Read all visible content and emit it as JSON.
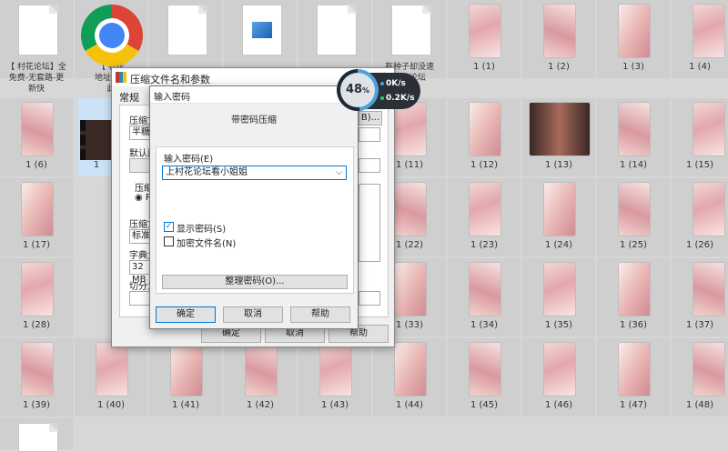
{
  "desktop": {
    "docs": [
      {
        "lines": [
          "【 村花论坛】全",
          "免费-无套路-更",
          "新快"
        ]
      },
      {
        "lines": [
          "【 村花",
          "地址发布",
          "此"
        ]
      },
      {
        "lines": [
          "",
          "",
          ""
        ]
      },
      {
        "lines": [
          "",
          "",
          ""
        ]
      },
      {
        "lines": [
          "",
          "",
          ""
        ]
      },
      {
        "lines": [
          "有种子却没速",
          "村花论坛",
          "是】"
        ]
      }
    ],
    "captions": {
      "row0": [
        "1 (1)",
        "1 (2)",
        "1 (3)",
        "1 (4)"
      ],
      "row1": [
        "1 (6)",
        "1",
        "1 (11)",
        "1 (12)",
        "1 (13)",
        "1 (14)",
        "1 (15)"
      ],
      "row2": [
        "1 (17)",
        "1 (22)",
        "1 (23)",
        "1 (24)",
        "1 (25)",
        "1 (26)"
      ],
      "row3": [
        "1 (28)",
        "1 (33)",
        "1 (34)",
        "1 (35)",
        "1 (36)",
        "1 (37)"
      ],
      "row4": [
        "1 (39)",
        "1 (40)",
        "1 (41)",
        "1 (42)",
        "1 (43)",
        "1 (44)",
        "1 (45)",
        "1 (46)",
        "1 (47)",
        "1 (48)"
      ]
    }
  },
  "compress_window": {
    "title": "压缩文件名和参数",
    "help_glyph": "?",
    "close_glyph": "✕",
    "tab_general": "常规",
    "frag_compress_file": "压缩文",
    "frag_browse": "B)...",
    "frag_value1": "半糖",
    "frag_default": "默认配",
    "frag_compress": "压缩",
    "frag_radio": "RA",
    "frag_method": "压缩方",
    "frag_standard": "标准",
    "frag_dict": "字典大",
    "frag_size": "32 MB",
    "frag_split": "切分为",
    "ok": "确定",
    "cancel": "取消",
    "help": "帮助"
  },
  "password_dialog": {
    "title": "输入密码",
    "header": "带密码压缩",
    "label_enter": "输入密码(E)",
    "password_value": "上村花论坛看小姐姐",
    "show_password": "显示密码(S)",
    "encrypt_names": "加密文件名(N)",
    "organize": "整理密码(O)...",
    "ok": "确定",
    "cancel": "取消",
    "help": "帮助"
  },
  "speed_meter": {
    "percent": "48",
    "percent_unit": "%",
    "up": "0K/s",
    "down": "0.2K/s"
  }
}
